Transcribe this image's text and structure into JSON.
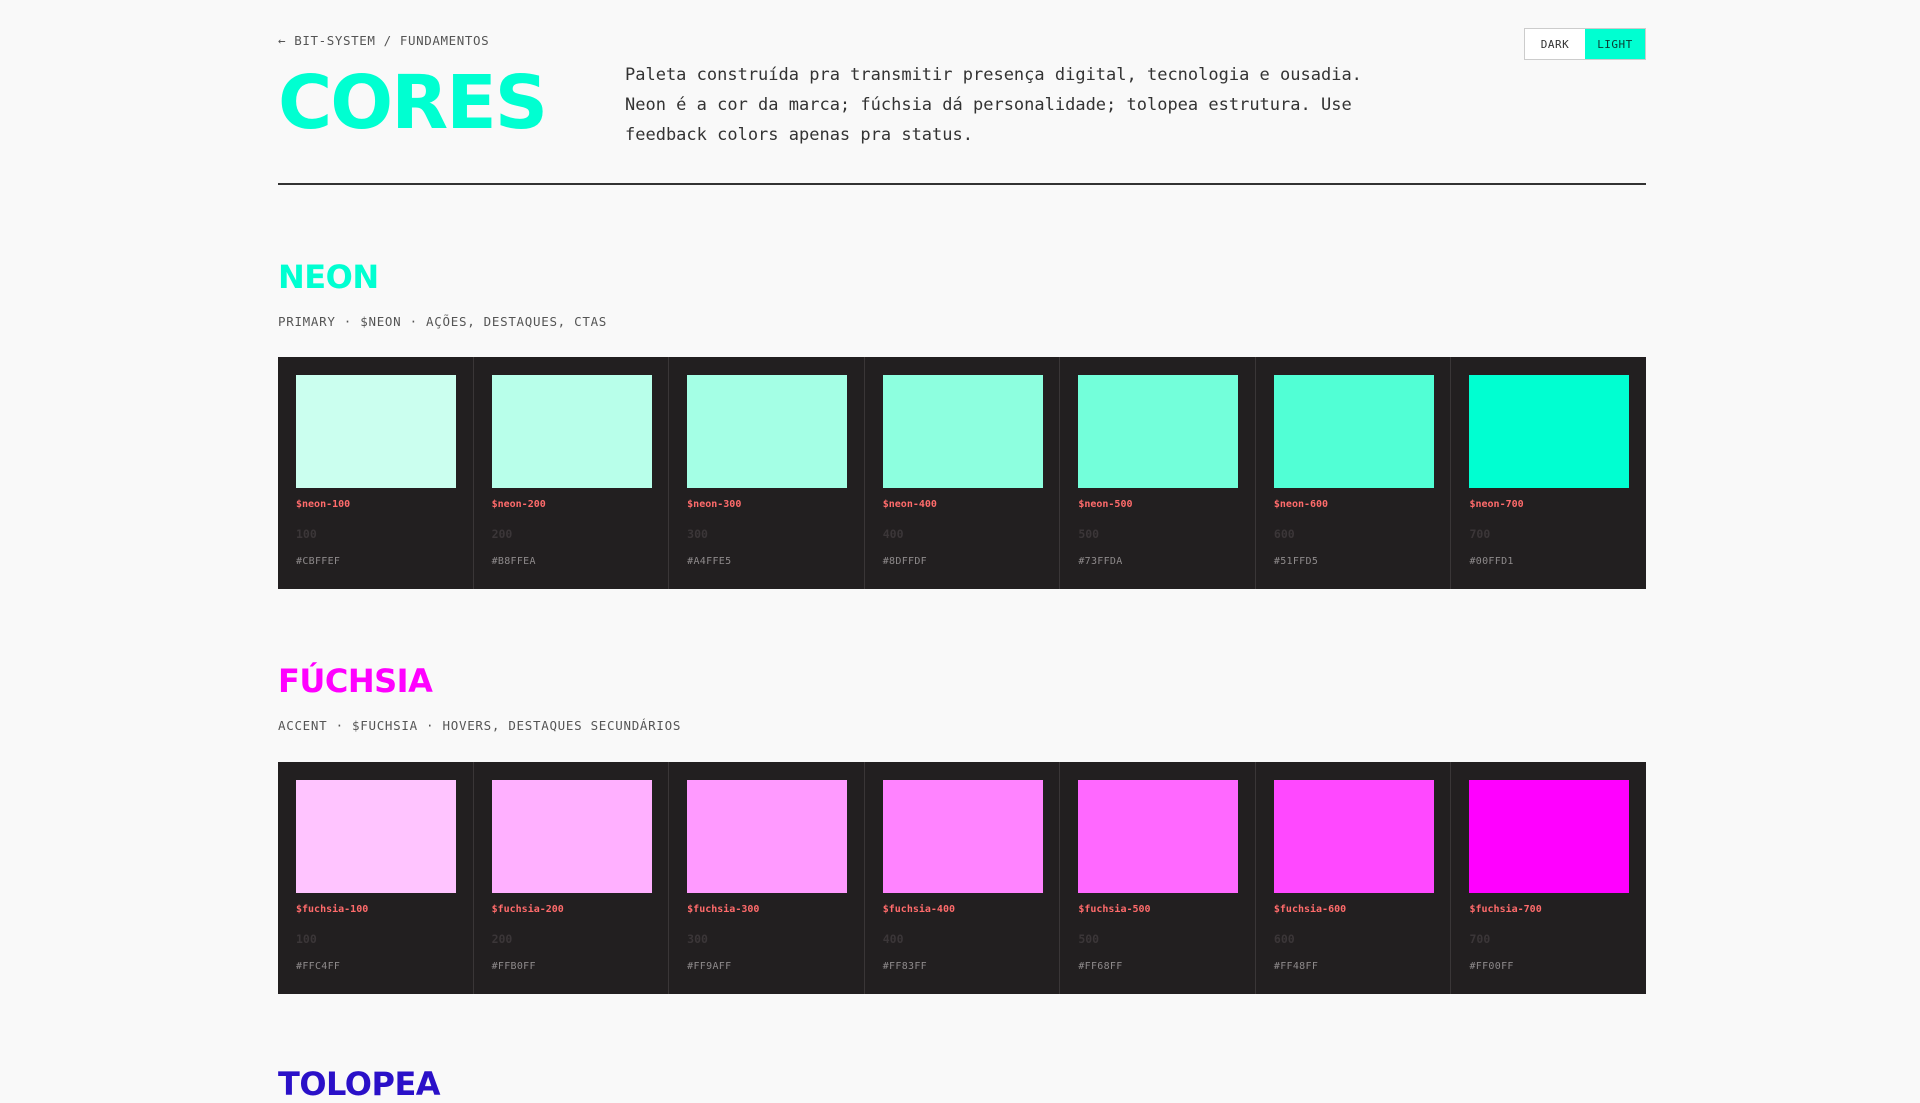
{
  "header": {
    "breadcrumb": "← BIT-SYSTEM / FUNDAMENTOS",
    "title": "CORES",
    "intro": "Paleta construída pra transmitir presença digital, tecnologia e ousadia. Neon é a cor da marca; fúchsia dá personalidade; tolopea estrutura. Use feedback colors apenas pra status."
  },
  "theme_toggle": {
    "dark_label": "DARK",
    "light_label": "LIGHT",
    "active": "LIGHT"
  },
  "colors": {
    "neon_accent": "#00FFD1",
    "fuchsia_accent": "#FF00FF",
    "tolopea_accent": "#2a10c8",
    "panel_bg": "#221f20",
    "token_label": "#ff6b6b"
  },
  "sections": [
    {
      "title": "NEON",
      "title_color": "#00FFD1",
      "subtitle": "PRIMARY · $NEON · AÇÕES, DESTAQUES, CTAS",
      "swatches": [
        {
          "token": "$neon-100",
          "weight": "100",
          "hex": "#CBFFEF"
        },
        {
          "token": "$neon-200",
          "weight": "200",
          "hex": "#B8FFEA"
        },
        {
          "token": "$neon-300",
          "weight": "300",
          "hex": "#A4FFE5"
        },
        {
          "token": "$neon-400",
          "weight": "400",
          "hex": "#8DFFDF"
        },
        {
          "token": "$neon-500",
          "weight": "500",
          "hex": "#73FFDA"
        },
        {
          "token": "$neon-600",
          "weight": "600",
          "hex": "#51FFD5"
        },
        {
          "token": "$neon-700",
          "weight": "700",
          "hex": "#00FFD1"
        }
      ]
    },
    {
      "title": "FÚCHSIA",
      "title_color": "#FF00FF",
      "subtitle": "ACCENT · $FUCHSIA · HOVERS, DESTAQUES SECUNDÁRIOS",
      "swatches": [
        {
          "token": "$fuchsia-100",
          "weight": "100",
          "hex": "#FFC4FF"
        },
        {
          "token": "$fuchsia-200",
          "weight": "200",
          "hex": "#FFB0FF"
        },
        {
          "token": "$fuchsia-300",
          "weight": "300",
          "hex": "#FF9AFF"
        },
        {
          "token": "$fuchsia-400",
          "weight": "400",
          "hex": "#FF83FF"
        },
        {
          "token": "$fuchsia-500",
          "weight": "500",
          "hex": "#FF68FF"
        },
        {
          "token": "$fuchsia-600",
          "weight": "600",
          "hex": "#FF48FF"
        },
        {
          "token": "$fuchsia-700",
          "weight": "700",
          "hex": "#FF00FF"
        }
      ]
    },
    {
      "title": "TOLOPEA",
      "title_color": "#2a10c8"
    }
  ]
}
